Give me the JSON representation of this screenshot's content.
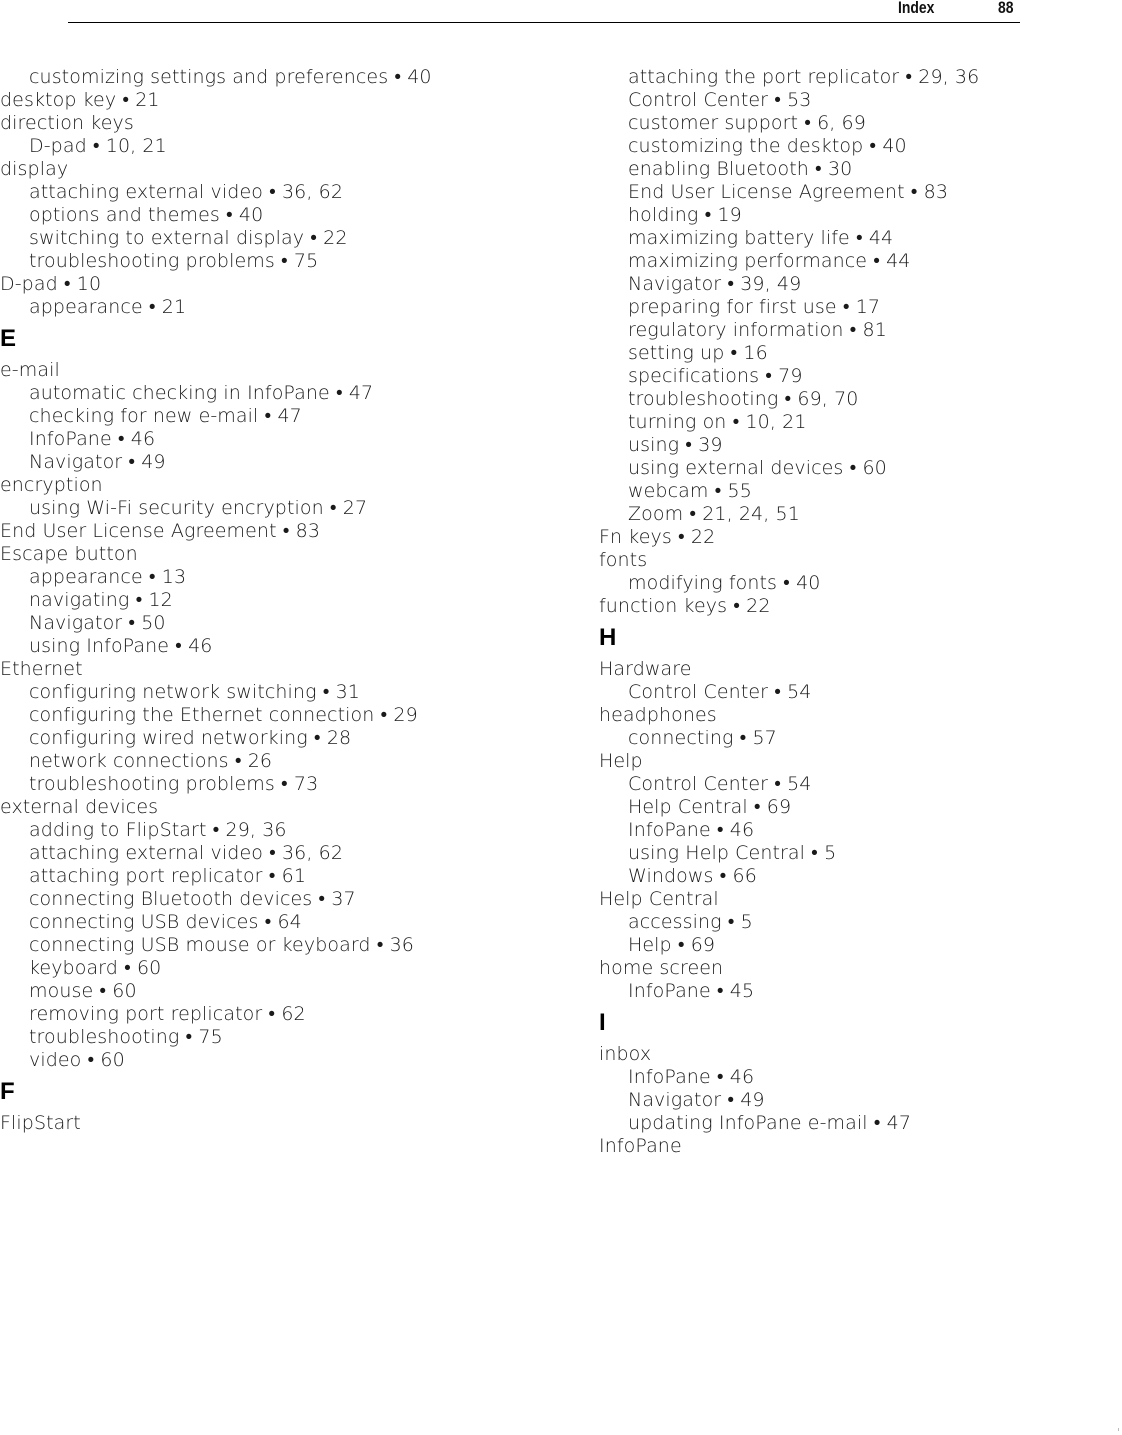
{
  "header": {
    "title": "Index",
    "page_number": "88"
  },
  "columns": [
    [
      {
        "type": "sub",
        "text": "customizing settings and preferences • 40"
      },
      {
        "type": "main",
        "text": "desktop key • 21"
      },
      {
        "type": "main",
        "text": "direction keys"
      },
      {
        "type": "sub",
        "text": "D-pad • 10, 21"
      },
      {
        "type": "main",
        "text": "display"
      },
      {
        "type": "sub",
        "text": "attaching external video • 36, 62"
      },
      {
        "type": "sub",
        "text": "options and themes • 40"
      },
      {
        "type": "sub",
        "text": "switching to external display • 22"
      },
      {
        "type": "sub",
        "text": "troubleshooting problems • 75"
      },
      {
        "type": "main",
        "text": "D-pad • 10"
      },
      {
        "type": "sub",
        "text": "appearance • 21"
      },
      {
        "type": "letter",
        "text": "E"
      },
      {
        "type": "main",
        "text": "e-mail"
      },
      {
        "type": "sub",
        "text": "automatic checking in InfoPane • 47"
      },
      {
        "type": "sub",
        "text": "checking for new e-mail • 47"
      },
      {
        "type": "sub",
        "text": "InfoPane • 46"
      },
      {
        "type": "sub",
        "text": "Navigator • 49"
      },
      {
        "type": "main",
        "text": "encryption"
      },
      {
        "type": "sub",
        "text": "using Wi-Fi security encryption • 27"
      },
      {
        "type": "main",
        "text": "End User License Agreement • 83"
      },
      {
        "type": "main",
        "text": "Escape button"
      },
      {
        "type": "sub",
        "text": "appearance • 13"
      },
      {
        "type": "sub",
        "text": "navigating • 12"
      },
      {
        "type": "sub",
        "text": "Navigator • 50"
      },
      {
        "type": "sub",
        "text": "using InfoPane • 46"
      },
      {
        "type": "main",
        "text": "Ethernet"
      },
      {
        "type": "sub",
        "text": "configuring network switching • 31"
      },
      {
        "type": "sub",
        "text": "configuring the Ethernet connection • 29"
      },
      {
        "type": "sub",
        "text": "configuring wired networking • 28"
      },
      {
        "type": "sub",
        "text": "network connections • 26"
      },
      {
        "type": "sub",
        "text": "troubleshooting problems • 73"
      },
      {
        "type": "main",
        "text": "external devices"
      },
      {
        "type": "sub",
        "text": "adding to FlipStart • 29, 36"
      },
      {
        "type": "sub",
        "text": "attaching external video • 36, 62"
      },
      {
        "type": "sub",
        "text": "attaching port replicator • 61"
      },
      {
        "type": "sub",
        "text": "connecting Bluetooth devices • 37"
      },
      {
        "type": "sub",
        "text": "connecting USB devices • 64"
      },
      {
        "type": "sub",
        "text": "connecting USB mouse or keyboard • 36"
      },
      {
        "type": "sub",
        "text": "keyboard • 60"
      },
      {
        "type": "sub",
        "text": "mouse • 60"
      },
      {
        "type": "sub",
        "text": "removing port replicator • 62"
      },
      {
        "type": "sub",
        "text": "troubleshooting • 75"
      },
      {
        "type": "sub",
        "text": "video • 60"
      },
      {
        "type": "letter",
        "text": "F"
      },
      {
        "type": "main",
        "text": "FlipStart"
      }
    ],
    [
      {
        "type": "sub",
        "text": "attaching the port replicator • 29, 36"
      },
      {
        "type": "sub",
        "text": "Control Center • 53"
      },
      {
        "type": "sub",
        "text": "customer support • 6, 69"
      },
      {
        "type": "sub",
        "text": "customizing the desktop • 40"
      },
      {
        "type": "sub",
        "text": "enabling Bluetooth • 30"
      },
      {
        "type": "sub",
        "text": "End User License Agreement • 83"
      },
      {
        "type": "sub",
        "text": "holding • 19"
      },
      {
        "type": "sub",
        "text": "maximizing battery life • 44"
      },
      {
        "type": "sub",
        "text": "maximizing performance • 44"
      },
      {
        "type": "sub",
        "text": "Navigator • 39, 49"
      },
      {
        "type": "sub",
        "text": "preparing for first use • 17"
      },
      {
        "type": "sub",
        "text": "regulatory information • 81"
      },
      {
        "type": "sub",
        "text": "setting up • 16"
      },
      {
        "type": "sub",
        "text": "specifications • 79"
      },
      {
        "type": "sub",
        "text": "troubleshooting • 69, 70"
      },
      {
        "type": "sub",
        "text": "turning on • 10, 21"
      },
      {
        "type": "sub",
        "text": "using • 39"
      },
      {
        "type": "sub",
        "text": "using external devices • 60"
      },
      {
        "type": "sub",
        "text": "webcam • 55"
      },
      {
        "type": "sub",
        "text": "Zoom • 21, 24, 51"
      },
      {
        "type": "main",
        "text": "Fn keys • 22"
      },
      {
        "type": "main",
        "text": "fonts"
      },
      {
        "type": "sub",
        "text": "modifying fonts • 40"
      },
      {
        "type": "main",
        "text": "function keys • 22"
      },
      {
        "type": "letter",
        "text": "H"
      },
      {
        "type": "main",
        "text": "Hardware"
      },
      {
        "type": "sub",
        "text": "Control Center • 54"
      },
      {
        "type": "main",
        "text": "headphones"
      },
      {
        "type": "sub",
        "text": "connecting • 57"
      },
      {
        "type": "main",
        "text": "Help"
      },
      {
        "type": "sub",
        "text": "Control Center • 54"
      },
      {
        "type": "sub",
        "text": "Help Central • 69"
      },
      {
        "type": "sub",
        "text": "InfoPane • 46"
      },
      {
        "type": "sub",
        "text": "using Help Central • 5"
      },
      {
        "type": "sub",
        "text": "Windows • 66"
      },
      {
        "type": "main",
        "text": "Help Central"
      },
      {
        "type": "sub",
        "text": "accessing • 5"
      },
      {
        "type": "sub",
        "text": "Help • 69"
      },
      {
        "type": "main",
        "text": "home screen"
      },
      {
        "type": "sub",
        "text": "InfoPane • 45"
      },
      {
        "type": "letter",
        "text": "I"
      },
      {
        "type": "main",
        "text": "inbox"
      },
      {
        "type": "sub",
        "text": "InfoPane • 46"
      },
      {
        "type": "sub",
        "text": "Navigator • 49"
      },
      {
        "type": "sub",
        "text": "updating InfoPane e-mail • 47"
      },
      {
        "type": "main",
        "text": "InfoPane"
      }
    ]
  ]
}
